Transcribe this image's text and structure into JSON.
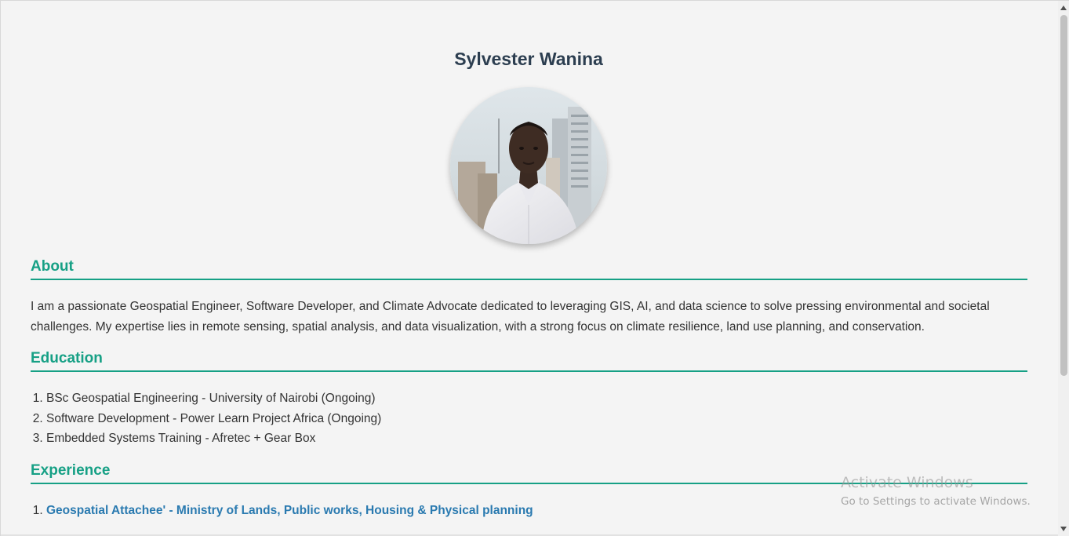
{
  "profile": {
    "name": "Sylvester Wanina",
    "photo_alt": "Profile Photo"
  },
  "about": {
    "title": "About",
    "text": "I am a passionate Geospatial Engineer, Software Developer, and Climate Advocate dedicated to leveraging GIS, AI, and data science to solve pressing environmental and societal challenges. My expertise lies in remote sensing, spatial analysis, and data visualization, with a strong focus on climate resilience, land use planning, and conservation."
  },
  "education": {
    "title": "Education",
    "items": [
      "BSc Geospatial Engineering - University of Nairobi (Ongoing)",
      "Software Development - Power Learn Project Africa (Ongoing)",
      "Embedded Systems Training - Afretec + Gear Box"
    ]
  },
  "experience": {
    "title": "Experience",
    "items": [
      "Geospatial Attachee' - Ministry of Lands, Public works, Housing & Physical planning"
    ]
  },
  "watermark": {
    "title": "Activate Windows",
    "subtitle": "Go to Settings to activate Windows."
  },
  "colors": {
    "background": "#f4f4f4",
    "heading": "#2c3e50",
    "section_accent": "#16a085",
    "link": "#2a7ab0",
    "body_text": "#333333"
  }
}
